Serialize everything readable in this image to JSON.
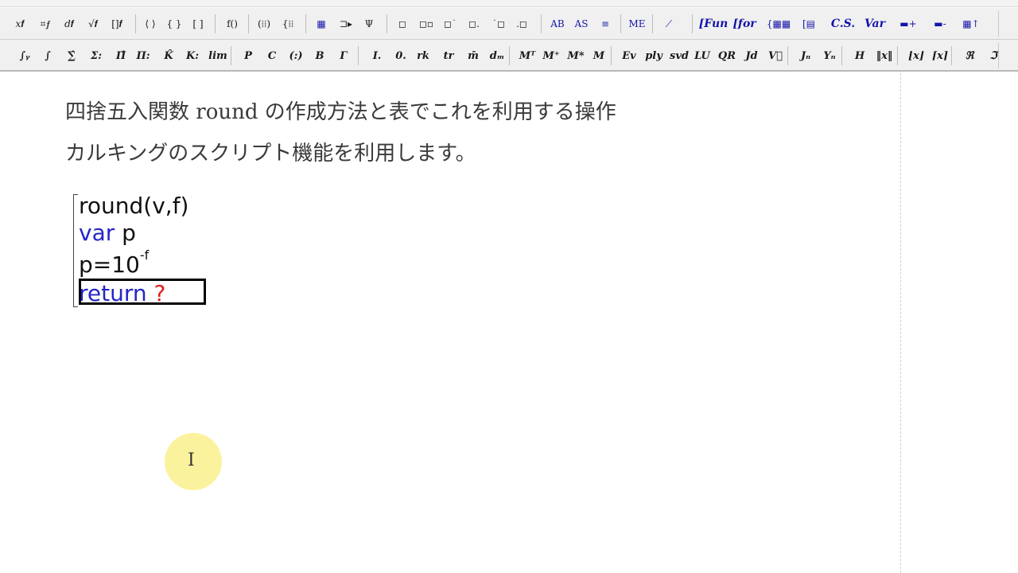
{
  "toolbar1": {
    "buttons": [
      {
        "id": "tb1-integral-edit",
        "label": "𝑥𝒇",
        "icon": "edit-formula-icon"
      },
      {
        "id": "tb1-matrix-edit",
        "label": "⌗𝒇",
        "icon": "matrix-edit-icon"
      },
      {
        "id": "tb1-deriv-edit",
        "label": "𝑑𝒇",
        "icon": "derivative-edit-icon"
      },
      {
        "id": "tb1-sqrt-edit",
        "label": "√𝒇",
        "icon": "sqrt-edit-icon"
      },
      {
        "id": "tb1-bracket-edit",
        "label": "[]𝒇",
        "icon": "bracket-edit-icon"
      },
      {
        "id": "tb1-angle-brackets",
        "label": "⟨ ⟩",
        "icon": "angle-brackets-icon"
      },
      {
        "id": "tb1-curly-brackets",
        "label": "{ }",
        "icon": "curly-brackets-icon"
      },
      {
        "id": "tb1-square-brackets",
        "label": "[ ]",
        "icon": "square-brackets-icon"
      },
      {
        "id": "tb1-function",
        "label": "f()",
        "icon": "function-icon"
      },
      {
        "id": "tb1-matrix-a",
        "label": "(⁞⁞)",
        "icon": "matrix-icon"
      },
      {
        "id": "tb1-matrix-b",
        "label": "{⁞⁞",
        "icon": "matrix-brace-icon"
      },
      {
        "id": "tb1-table",
        "label": "▦",
        "icon": "table-icon"
      },
      {
        "id": "tb1-tree-a",
        "label": "⊐▸",
        "icon": "tree-icon"
      },
      {
        "id": "tb1-tree-b",
        "label": "Ψ",
        "icon": "tree-branch-icon"
      },
      {
        "id": "tb1-box-a",
        "label": "◻",
        "icon": "box-icon"
      },
      {
        "id": "tb1-box-b",
        "label": "◻▫",
        "icon": "box-sub-icon"
      },
      {
        "id": "tb1-box-c",
        "label": "◻˙",
        "icon": "box-sup-icon"
      },
      {
        "id": "tb1-box-d",
        "label": "◻.",
        "icon": "box-dot-icon"
      },
      {
        "id": "tb1-box-e",
        "label": "˙◻",
        "icon": "box-pre-icon"
      },
      {
        "id": "tb1-box-f",
        "label": ".◻",
        "icon": "box-pre-sub-icon"
      },
      {
        "id": "tb1-stack-a",
        "label": "AB",
        "icon": "stack-icon"
      },
      {
        "id": "tb1-stack-b",
        "label": "AS",
        "icon": "stack-b-icon"
      },
      {
        "id": "tb1-stack-c",
        "label": "≡",
        "icon": "stack-c-icon"
      },
      {
        "id": "tb1-stack-d",
        "label": "ME",
        "icon": "stack-d-icon"
      },
      {
        "id": "tb1-plot",
        "label": "⟋",
        "icon": "plot-icon"
      },
      {
        "id": "tb1-fun",
        "label": "[Fun",
        "icon": "fun-block-icon"
      },
      {
        "id": "tb1-for",
        "label": "[for",
        "icon": "for-block-icon"
      },
      {
        "id": "tb1-grid-a",
        "label": "{▦▦",
        "icon": "grid-brace-icon"
      },
      {
        "id": "tb1-grid-b",
        "label": "[▤",
        "icon": "grid-list-icon"
      },
      {
        "id": "tb1-cs",
        "label": "C.S.",
        "icon": "cs-icon"
      },
      {
        "id": "tb1-var",
        "label": "Var",
        "icon": "var-icon"
      },
      {
        "id": "tb1-addrow",
        "label": "▬+",
        "icon": "add-row-icon"
      },
      {
        "id": "tb1-delrow",
        "label": "▬-",
        "icon": "delete-row-icon"
      },
      {
        "id": "tb1-tableup",
        "label": "▦↑",
        "icon": "table-up-icon"
      }
    ]
  },
  "toolbar2": {
    "buttons": [
      {
        "id": "tb2-integral-bounds",
        "label": "∫ᵧ",
        "icon": "integral-bounds-icon"
      },
      {
        "id": "tb2-integral",
        "label": "∫",
        "icon": "integral-icon"
      },
      {
        "id": "tb2-sum-bounds",
        "label": "∑̂",
        "icon": "sum-bounds-icon"
      },
      {
        "id": "tb2-sum",
        "label": "Σ:",
        "icon": "sum-icon"
      },
      {
        "id": "tb2-product-bounds",
        "label": "Π̂",
        "icon": "product-bounds-icon"
      },
      {
        "id": "tb2-product",
        "label": "Π:",
        "icon": "product-icon"
      },
      {
        "id": "tb2-coproduct-bounds",
        "label": "K̂",
        "icon": "k-bounds-icon"
      },
      {
        "id": "tb2-coproduct",
        "label": "K:",
        "icon": "k-icon"
      },
      {
        "id": "tb2-lim",
        "label": "lim",
        "icon": "limit-icon"
      },
      {
        "id": "tb2-perm",
        "label": "P",
        "icon": "permutation-icon"
      },
      {
        "id": "tb2-comb",
        "label": "C",
        "icon": "combination-icon"
      },
      {
        "id": "tb2-binom",
        "label": "(:)",
        "icon": "binomial-icon"
      },
      {
        "id": "tb2-beta",
        "label": "B",
        "icon": "beta-icon"
      },
      {
        "id": "tb2-gamma",
        "label": "Γ",
        "icon": "gamma-icon"
      },
      {
        "id": "tb2-identity",
        "label": "I.",
        "icon": "identity-icon"
      },
      {
        "id": "tb2-zero",
        "label": "0.",
        "icon": "zero-matrix-icon"
      },
      {
        "id": "tb2-rank",
        "label": "rk",
        "icon": "rank-icon"
      },
      {
        "id": "tb2-trace",
        "label": "tr",
        "icon": "trace-icon"
      },
      {
        "id": "tb2-mean",
        "label": "m̄",
        "icon": "mean-icon"
      },
      {
        "id": "tb2-dm",
        "label": "dₘ",
        "icon": "dm-icon"
      },
      {
        "id": "tb2-transpose",
        "label": "Mᵀ",
        "icon": "transpose-icon"
      },
      {
        "id": "tb2-adjoint",
        "label": "M⁺",
        "icon": "adjoint-icon"
      },
      {
        "id": "tb2-conj",
        "label": "M*",
        "icon": "conjugate-icon"
      },
      {
        "id": "tb2-m",
        "label": "M",
        "icon": "matrix-m-icon"
      },
      {
        "id": "tb2-ev",
        "label": "Ev",
        "icon": "eigenvalue-icon"
      },
      {
        "id": "tb2-ply",
        "label": "ply",
        "icon": "polynomial-icon"
      },
      {
        "id": "tb2-svd",
        "label": "svd",
        "icon": "svd-icon"
      },
      {
        "id": "tb2-lu",
        "label": "LU",
        "icon": "lu-icon"
      },
      {
        "id": "tb2-qr",
        "label": "QR",
        "icon": "qr-icon"
      },
      {
        "id": "tb2-jd",
        "label": "Jd",
        "icon": "jordan-icon"
      },
      {
        "id": "tb2-vec",
        "label": "V⃗",
        "icon": "vector-icon"
      },
      {
        "id": "tb2-bessel-j",
        "label": "Jₙ",
        "icon": "bessel-j-icon"
      },
      {
        "id": "tb2-bessel-y",
        "label": "Yₙ",
        "icon": "bessel-y-icon"
      },
      {
        "id": "tb2-hermite",
        "label": "H",
        "icon": "hermite-icon"
      },
      {
        "id": "tb2-norm",
        "label": "‖x‖",
        "icon": "norm-icon"
      },
      {
        "id": "tb2-floor",
        "label": "⌊x⌋",
        "icon": "floor-icon"
      },
      {
        "id": "tb2-ceil",
        "label": "⌈x⌉",
        "icon": "ceiling-icon"
      },
      {
        "id": "tb2-real",
        "label": "ℜ",
        "icon": "real-part-icon"
      },
      {
        "id": "tb2-imag",
        "label": "ℑ",
        "icon": "imag-part-icon"
      }
    ]
  },
  "document": {
    "heading1": "四捨五入関数 round の作成方法と表でこれを利用する操作",
    "heading2": "カルキングのスクリプト機能を利用します。",
    "script": {
      "line1": "round(v,f)",
      "line2_keyword": "var",
      "line2_rest": " p",
      "line3_base": "p=10",
      "line3_exp": "-f",
      "line4_keyword": "return",
      "line4_placeholder": "?"
    }
  },
  "colors": {
    "keyword": "#2525c8",
    "placeholder": "#e02020",
    "pointer_highlight": "#faf08c"
  },
  "pointer": {
    "icon": "ibeam-cursor-icon",
    "glyph": "I"
  }
}
